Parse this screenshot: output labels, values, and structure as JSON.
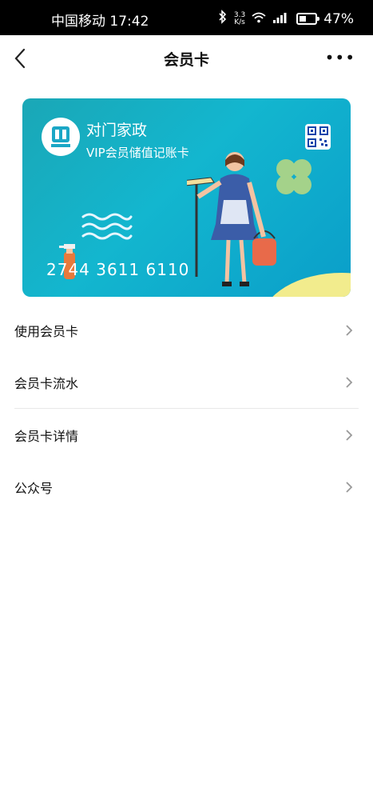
{
  "status_bar": {
    "carrier_time": "中国移动 17:42",
    "net_speed_top": "3.3",
    "net_speed_bottom": "K/s",
    "battery_percent": "47%"
  },
  "header": {
    "title": "会员卡",
    "more_label": "•••"
  },
  "card": {
    "brand": "对门家政",
    "subtitle": "VIP会员储值记账卡",
    "number": "2744 3611 6110",
    "colors": {
      "start": "#1aa7b6",
      "mid": "#13b6cf",
      "end": "#0a9ec9"
    }
  },
  "menu": {
    "items": [
      {
        "label": "使用会员卡"
      },
      {
        "label": "会员卡流水"
      },
      {
        "label": "会员卡详情"
      },
      {
        "label": "公众号"
      }
    ]
  }
}
